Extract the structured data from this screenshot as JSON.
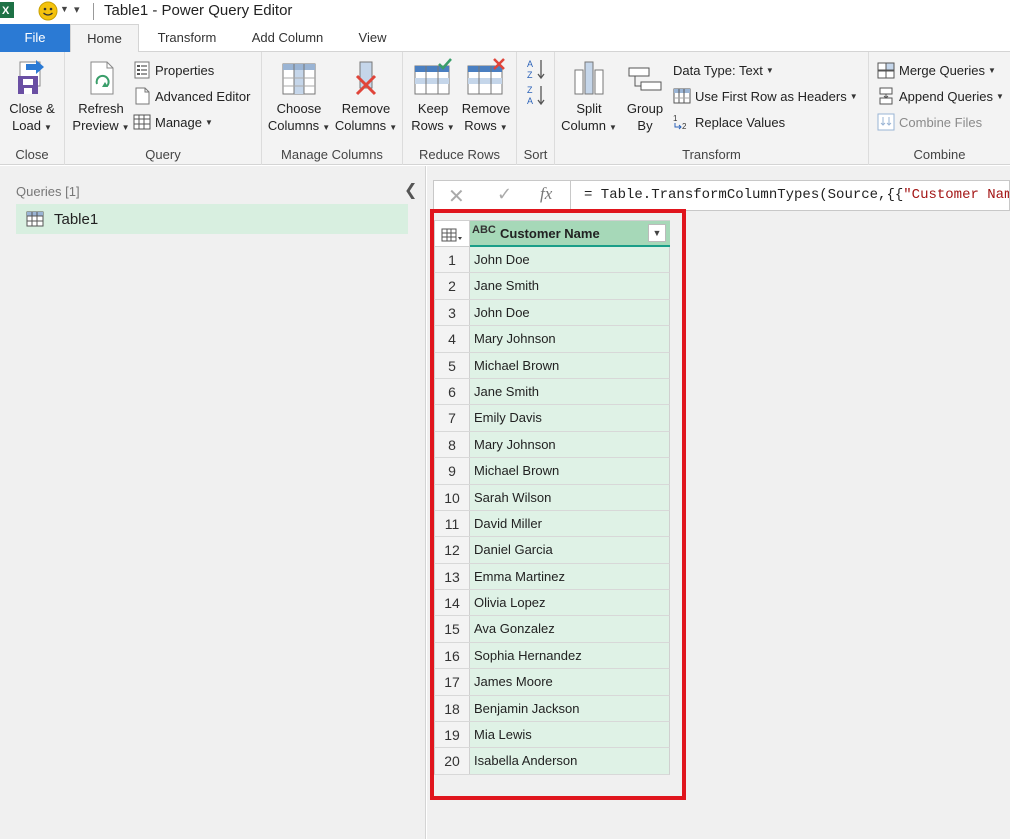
{
  "window": {
    "title": "Table1 - Power Query Editor"
  },
  "tabs": [
    "File",
    "Home",
    "Transform",
    "Add Column",
    "View"
  ],
  "ribbon": {
    "close": {
      "close_load": [
        "Close &",
        "Load"
      ],
      "label": "Close"
    },
    "query": {
      "refresh": [
        "Refresh",
        "Preview"
      ],
      "properties": "Properties",
      "advanced_editor": "Advanced Editor",
      "manage": "Manage",
      "label": "Query"
    },
    "manage_columns": {
      "choose": [
        "Choose",
        "Columns"
      ],
      "remove": [
        "Remove",
        "Columns"
      ],
      "label": "Manage Columns"
    },
    "reduce_rows": {
      "keep": [
        "Keep",
        "Rows"
      ],
      "remove": [
        "Remove",
        "Rows"
      ],
      "label": "Reduce Rows"
    },
    "sort": {
      "label": "Sort"
    },
    "transform": {
      "split": [
        "Split",
        "Column"
      ],
      "group": [
        "Group",
        "By"
      ],
      "data_type": "Data Type: Text",
      "first_row": "Use First Row as Headers",
      "replace": "Replace Values",
      "label": "Transform"
    },
    "combine": {
      "merge": "Merge Queries",
      "append": "Append Queries",
      "combine_files": "Combine Files",
      "label": "Combine"
    }
  },
  "left_panel": {
    "queries_label": "Queries [1]",
    "items": [
      "Table1"
    ]
  },
  "formula_bar": {
    "prefix": "= Table.TransformColumnTypes(Source,{{",
    "string": "\"Customer Nam"
  },
  "grid": {
    "type_label": "ABC",
    "column": "Customer Name",
    "rows": [
      {
        "n": "1",
        "name": "John Doe"
      },
      {
        "n": "2",
        "name": "Jane Smith"
      },
      {
        "n": "3",
        "name": "John Doe"
      },
      {
        "n": "4",
        "name": "Mary Johnson"
      },
      {
        "n": "5",
        "name": "Michael Brown"
      },
      {
        "n": "6",
        "name": "Jane Smith"
      },
      {
        "n": "7",
        "name": "Emily Davis"
      },
      {
        "n": "8",
        "name": "Mary Johnson"
      },
      {
        "n": "9",
        "name": "Michael Brown"
      },
      {
        "n": "10",
        "name": "Sarah Wilson"
      },
      {
        "n": "11",
        "name": "David Miller"
      },
      {
        "n": "12",
        "name": "Daniel Garcia"
      },
      {
        "n": "13",
        "name": "Emma Martinez"
      },
      {
        "n": "14",
        "name": "Olivia Lopez"
      },
      {
        "n": "15",
        "name": "Ava Gonzalez"
      },
      {
        "n": "16",
        "name": "Sophia Hernandez"
      },
      {
        "n": "17",
        "name": "James Moore"
      },
      {
        "n": "18",
        "name": "Benjamin Jackson"
      },
      {
        "n": "19",
        "name": "Mia Lewis"
      },
      {
        "n": "20",
        "name": "Isabella Anderson"
      }
    ]
  },
  "colors": {
    "accent": "#2b7ad4",
    "highlight_box": "#e0151d",
    "selected_column": "#a6d8b8",
    "column_quality_bar": "#1a9e88",
    "cell_fill": "#dff2e6"
  }
}
